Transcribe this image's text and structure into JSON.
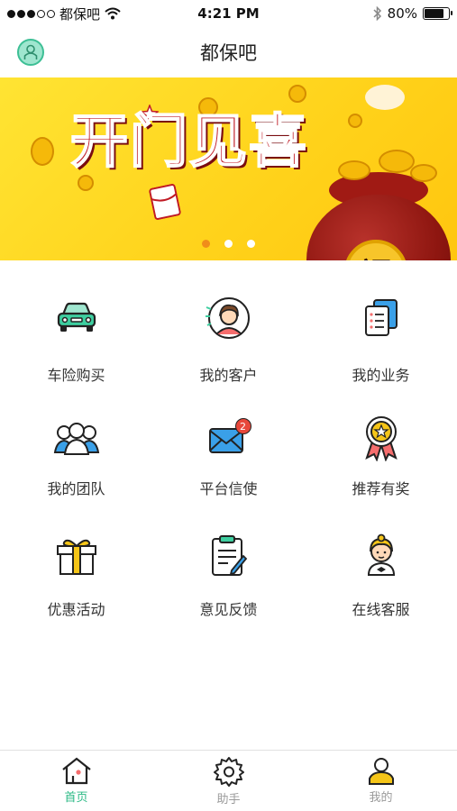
{
  "status_bar": {
    "carrier": "都保吧",
    "time": "4:21 PM",
    "battery": "80%",
    "battery_level": 0.8
  },
  "header": {
    "title": "都保吧"
  },
  "banner": {
    "headline": [
      "开",
      "门",
      "见",
      "喜"
    ],
    "seal_text": "福",
    "page_count": 3,
    "active_page": 1
  },
  "grid": {
    "items": [
      {
        "label": "车险购买",
        "icon": "car-icon"
      },
      {
        "label": "我的客户",
        "icon": "customer-avatar-icon"
      },
      {
        "label": "我的业务",
        "icon": "documents-icon"
      },
      {
        "label": "我的团队",
        "icon": "team-icon"
      },
      {
        "label": "平台信使",
        "icon": "mail-icon",
        "badge": "2"
      },
      {
        "label": "推荐有奖",
        "icon": "medal-icon"
      },
      {
        "label": "优惠活动",
        "icon": "gift-icon"
      },
      {
        "label": "意见反馈",
        "icon": "clipboard-icon"
      },
      {
        "label": "在线客服",
        "icon": "service-agent-icon"
      }
    ]
  },
  "tabs": [
    {
      "label": "首页",
      "icon": "home-icon",
      "active": true
    },
    {
      "label": "助手",
      "icon": "gear-icon",
      "active": false
    },
    {
      "label": "我的",
      "icon": "person-icon",
      "active": false
    }
  ],
  "colors": {
    "accent": "#2bb985",
    "banner_yellow": "#ffd21a",
    "banner_red": "#c01a24",
    "badge_red": "#e8483b"
  }
}
